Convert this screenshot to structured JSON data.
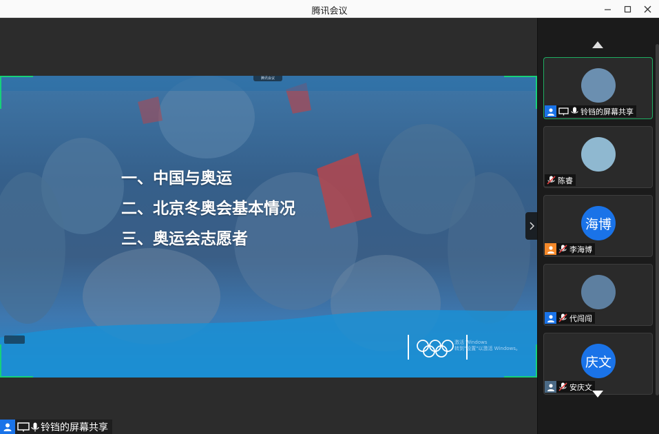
{
  "window": {
    "title": "腾讯会议"
  },
  "slide": {
    "share_tag": "腾讯会议",
    "agenda": [
      "一、中国与奥运",
      "二、北京冬奥会基本情况",
      "三、奥运会志愿者"
    ],
    "activate_line1": "激活 Windows",
    "activate_line2": "转到\"设置\"以激活 Windows。"
  },
  "bottom_tag": {
    "name": "铃铛的屏幕共享"
  },
  "participants": [
    {
      "name": "铃铛的屏幕共享",
      "avatar_text": "",
      "avatar_color": "#6b8fb0",
      "icon_color": "#1a73e8",
      "active": true,
      "muted": false,
      "sharing": true
    },
    {
      "name": "陈睿",
      "avatar_text": "",
      "avatar_color": "#8fb8d0",
      "icon_color": "",
      "active": false,
      "muted": true,
      "sharing": false
    },
    {
      "name": "李海博",
      "avatar_text": "海博",
      "avatar_color": "#1a73e8",
      "icon_color": "#f5892a",
      "active": false,
      "muted": true,
      "sharing": false
    },
    {
      "name": "代闯闯",
      "avatar_text": "",
      "avatar_color": "#5d7fa0",
      "icon_color": "#1a73e8",
      "active": false,
      "muted": true,
      "sharing": false
    },
    {
      "name": "安庆文",
      "avatar_text": "庆文",
      "avatar_color": "#1a73e8",
      "icon_color": "#4b6a86",
      "active": false,
      "muted": true,
      "sharing": false
    }
  ],
  "colors": {
    "accent_green": "#17d07a",
    "brand_blue": "#1a73e8",
    "muted_red": "#e04040"
  }
}
